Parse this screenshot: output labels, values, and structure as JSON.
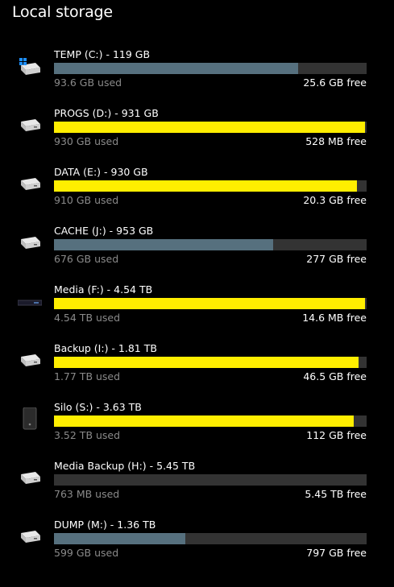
{
  "page": {
    "title": "Local storage"
  },
  "colors": {
    "normal": "#56707e",
    "warning": "#ffee00",
    "track": "#333333"
  },
  "drives": [
    {
      "name": "TEMP (C:) - 119 GB",
      "used": "93.6 GB used",
      "free": "25.6 GB free",
      "fill": 0.78,
      "state": "normal",
      "icon": "windows-drive-icon"
    },
    {
      "name": "PROGS (D:) - 931 GB",
      "used": "930 GB used",
      "free": "528 MB free",
      "fill": 0.995,
      "state": "warning",
      "icon": "hard-drive-icon"
    },
    {
      "name": "DATA (E:) - 930 GB",
      "used": "910 GB used",
      "free": "20.3 GB free",
      "fill": 0.97,
      "state": "warning",
      "icon": "hard-drive-icon"
    },
    {
      "name": "CACHE (J:) - 953 GB",
      "used": "676 GB used",
      "free": "277 GB free",
      "fill": 0.7,
      "state": "normal",
      "icon": "hard-drive-icon"
    },
    {
      "name": "Media (F:) - 4.54 TB",
      "used": "4.54 TB used",
      "free": "14.6 MB free",
      "fill": 0.995,
      "state": "warning",
      "icon": "network-drive-icon"
    },
    {
      "name": "Backup (I:) - 1.81 TB",
      "used": "1.77 TB used",
      "free": "46.5 GB free",
      "fill": 0.975,
      "state": "warning",
      "icon": "hard-drive-icon"
    },
    {
      "name": "Silo (S:) - 3.63 TB",
      "used": "3.52 TB used",
      "free": "112 GB free",
      "fill": 0.96,
      "state": "warning",
      "icon": "external-drive-icon"
    },
    {
      "name": "Media Backup (H:) - 5.45 TB",
      "used": "763 MB used",
      "free": "5.45 TB free",
      "fill": 0.0001,
      "state": "normal",
      "icon": "hard-drive-icon"
    },
    {
      "name": "DUMP (M:) - 1.36 TB",
      "used": "599 GB used",
      "free": "797 GB free",
      "fill": 0.42,
      "state": "normal",
      "icon": "hard-drive-icon"
    }
  ]
}
